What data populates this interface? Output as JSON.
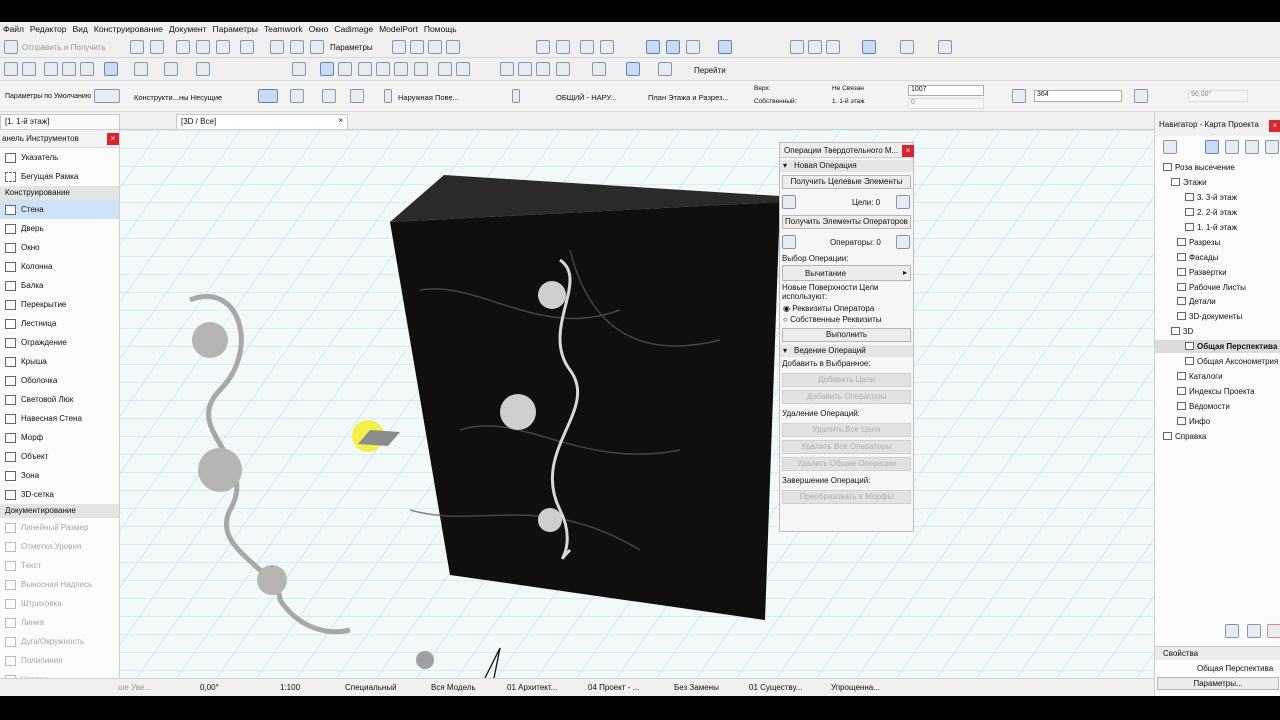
{
  "menu": [
    "Файл",
    "Редактор",
    "Вид",
    "Конструирование",
    "Документ",
    "Параметры",
    "Teamwork",
    "Окно",
    "Cadimage",
    "ModelPort",
    "Помощь"
  ],
  "toolbar1": {
    "send_receive": "Отправить и Получить",
    "params": "Параметры"
  },
  "toolbar2": {
    "go": "Перейти"
  },
  "infobox": {
    "default_params": "Параметры по Умолчанию",
    "structure": "Конструкти...ны Несущие",
    "surface": "Наружная Пове...",
    "composite": "ОБЩИЙ - НАРУ...",
    "plan_section": "План Этажа и Разрез...",
    "top_label": "Верх:",
    "top_value": "Не Связан",
    "own_label": "Собственный:",
    "own_value": "1. 1-й этаж",
    "height": "1007",
    "offset": "0",
    "thickness": "364",
    "angle": "90,00°"
  },
  "tabs": {
    "floor": "[1. 1-й этаж]",
    "view3d": "[3D / Все]"
  },
  "toolbox": {
    "title": "анель Инструментов",
    "pointer": "Указатель",
    "marquee": "Бегущая Рамка",
    "section_design": "Конструирование",
    "design_tools": [
      "Стена",
      "Дверь",
      "Окно",
      "Колонна",
      "Балка",
      "Перекрытие",
      "Лестница",
      "Ограждение",
      "Крыша",
      "Оболочка",
      "Световой Люк",
      "Навесная Стена",
      "Морф",
      "Объект",
      "Зона",
      "3D-сетка"
    ],
    "section_doc": "Документирование",
    "doc_tools": [
      "Линейный Размер",
      "Отметка Уровня",
      "Текст",
      "Выносная Надпись",
      "Штриховка",
      "Линия",
      "Дуга/Окружность",
      "Полилиния",
      "Чертеж"
    ]
  },
  "solid_ops": {
    "title": "Операции Твердотельного М...",
    "new_op": "Новая Операция",
    "get_targets": "Получить Целевые Элементы",
    "targets_label": "Цели: 0",
    "get_operators": "Получить Элементы Операторов",
    "operators_label": "Операторы: 0",
    "choose_op": "Выбор Операции:",
    "operation": "Вычитание",
    "new_surfaces": "Новые Поверхности Цели используют:",
    "opt_operator": "Реквизиты Оператора",
    "opt_own": "Собственные Реквизиты",
    "execute": "Выполнить",
    "manage": "Ведение Операций",
    "add_to_sel": "Добавить в Выбранное:",
    "add_targets": "Добавить Цели",
    "add_operators": "Добавить Операторы",
    "remove_ops": "Удаление Операций:",
    "remove_targets": "Удалить Все Цели",
    "remove_operators": "Удалить Все Операторы",
    "remove_common": "Удалить Общие Операции",
    "finish": "Завершение Операций:",
    "convert": "Преобразовать в Морфы"
  },
  "navigator": {
    "title": "Навигатор - Карта Проекта",
    "items": [
      "Роза высечение",
      "Этажи",
      "3. 3-й этаж",
      "2. 2-й этаж",
      "1. 1-й этаж",
      "Разрезы",
      "Фасады",
      "Развертки",
      "Рабочие Листы",
      "Детали",
      "3D-документы",
      "3D",
      "Общая Перспектива",
      "Общая Аксонометрия",
      "Каталоги",
      "Индексы Проекта",
      "Ведомости",
      "Инфо",
      "Справка"
    ],
    "props_title": "Свойства",
    "props_value": "Общая Перспектива",
    "props_button": "Параметры..."
  },
  "status": {
    "s0": "ше Уве...",
    "angle": "0,00°",
    "scale": "1:100",
    "special": "Специальный",
    "model": "Вся Модель",
    "arch": "01 Архитект...",
    "project": "04 Проект - ...",
    "nochange": "Без Замены",
    "existing": "01 Существу...",
    "simplified": "Упрощенна..."
  },
  "colors": {
    "accent": "#cfe3f8",
    "grid": "#7fd6e0",
    "close": "#d9262c",
    "marble": "#141414"
  }
}
